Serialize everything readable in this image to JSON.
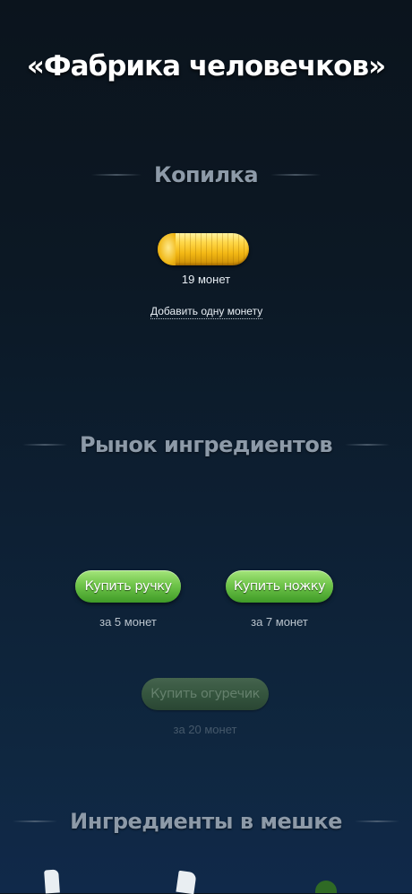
{
  "header": {
    "title": "«Фабрика человечков»"
  },
  "piggy_bank": {
    "heading": "Копилка",
    "coin_count_label": "19 монет",
    "add_coin_link": "Добавить одну монету"
  },
  "market": {
    "heading": "Рынок ингредиентов",
    "items": [
      {
        "button_label": "Купить ручку",
        "price_label": "за 5 монет",
        "enabled": true
      },
      {
        "button_label": "Купить ножку",
        "price_label": "за 7 монет",
        "enabled": true
      },
      {
        "button_label": "Купить огуречик",
        "price_label": "за 20 монет",
        "enabled": false
      }
    ]
  },
  "bag": {
    "heading": "Ингредиенты в мешке"
  },
  "colors": {
    "button_green": "#6fc54a",
    "coin_gold": "#f3b814",
    "heading_gray": "#8d9aa8"
  }
}
